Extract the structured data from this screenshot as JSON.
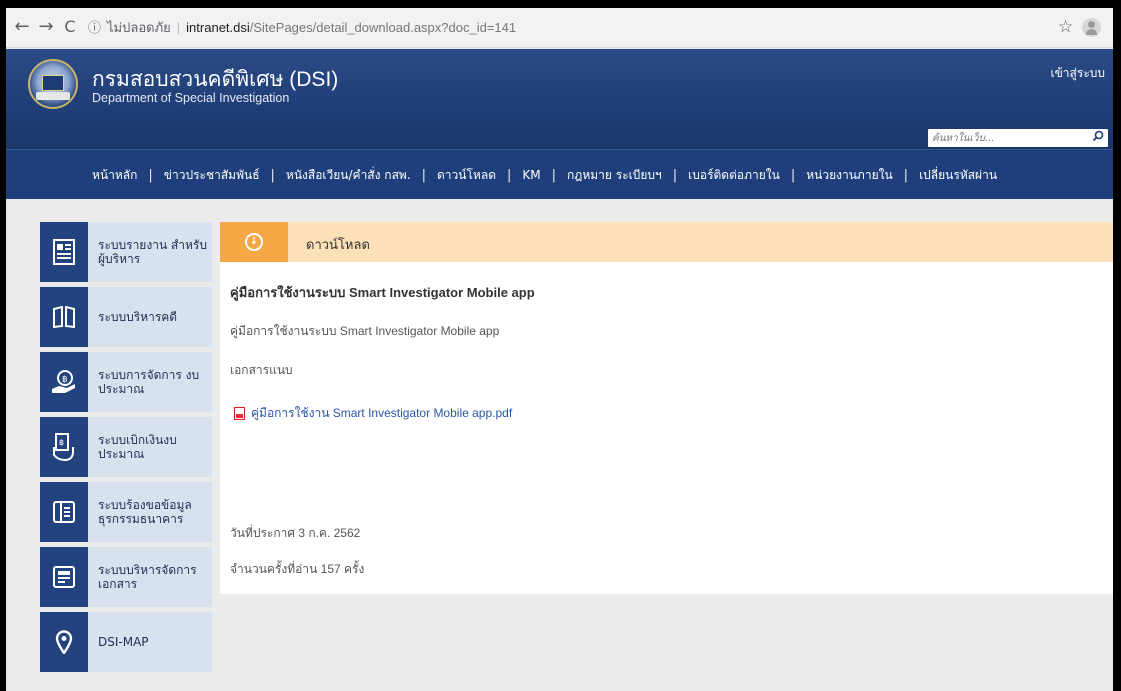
{
  "browser": {
    "security_label": "ไม่ปลอดภัย",
    "url_host": "intranet.dsi",
    "url_path": "/SitePages/detail_download.aspx?doc_id=141",
    "back_icon": "←",
    "forward_icon": "→",
    "reload_icon": "C",
    "info_icon": "ⓘ",
    "star_icon": "☆"
  },
  "header": {
    "title": "กรมสอบสวนคดีพิเศษ (DSI)",
    "subtitle": "Department of Special Investigation",
    "login_label": "เข้าสู่ระบบ",
    "search_placeholder": "ค้นหาในเว็บ...",
    "search_icon": "⚲"
  },
  "menu": {
    "items": [
      "หน้าหลัก",
      "ข่าวประชาสัมพันธ์",
      "หนังสือเวียน/คำสั่ง กสพ.",
      "ดาวน์โหลด",
      "KM",
      "กฎหมาย ระเบียบฯ",
      "เบอร์ติดต่อภายใน",
      "หน่วยงานภายใน",
      "เปลี่ยนรหัสผ่าน"
    ],
    "separator": "|"
  },
  "sidebar": {
    "items": [
      {
        "label": "ระบบรายงาน สำหรับผู้บริหาร",
        "icon": "report-icon"
      },
      {
        "label": "ระบบบริหารคดี",
        "icon": "book-icon"
      },
      {
        "label": "ระบบการจัดการ งบประมาณ",
        "icon": "budget-hand-icon"
      },
      {
        "label": "ระบบเบิกเงินงบประมาณ",
        "icon": "withdraw-icon"
      },
      {
        "label": "ระบบร้องขอข้อมูล ธุรกรรมธนาคาร",
        "icon": "bank-record-icon"
      },
      {
        "label": "ระบบบริหารจัดการ เอกสาร",
        "icon": "document-icon"
      },
      {
        "label": "DSI-MAP",
        "icon": "map-pin-icon"
      }
    ]
  },
  "download": {
    "section_title": "ดาวน์โหลด",
    "doc_title": "คู่มือการใช้งานระบบ Smart Investigator Mobile app",
    "doc_description": "คู่มือการใช้งานระบบ Smart Investigator Mobile app",
    "attachment_label": "เอกสารแนบ",
    "file_name": "คู่มือการใช้งาน Smart Investigator Mobile app.pdf",
    "publish_date": "วันที่ประกาศ 3 ก.ค. 2562",
    "read_count": "จำนวนครั้งที่อ่าน 157 ครั้ง"
  },
  "colors": {
    "header_blue": "#1f3d76",
    "sidebar_icon_bg": "#22437e",
    "sidebar_item_bg": "#d8e1ee",
    "download_banner": "#fbe0b8",
    "download_badge": "#f5a845",
    "link": "#2a55a8"
  }
}
